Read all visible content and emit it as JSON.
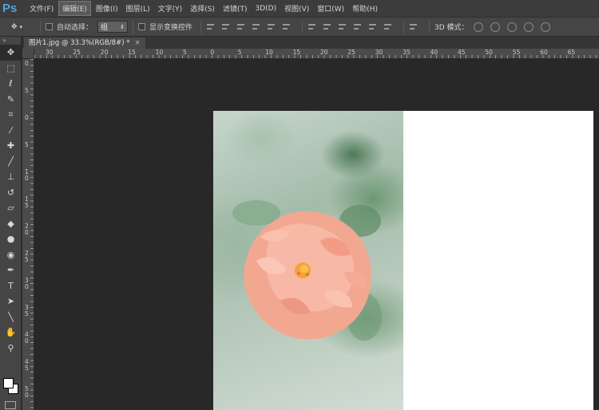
{
  "app": {
    "logo": "Ps"
  },
  "menu": [
    {
      "label": "文件(F)"
    },
    {
      "label": "编辑(E)"
    },
    {
      "label": "图像(I)"
    },
    {
      "label": "图层(L)"
    },
    {
      "label": "文字(Y)"
    },
    {
      "label": "选择(S)"
    },
    {
      "label": "滤镜(T)"
    },
    {
      "label": "3D(D)"
    },
    {
      "label": "视图(V)"
    },
    {
      "label": "窗口(W)"
    },
    {
      "label": "帮助(H)"
    }
  ],
  "options": {
    "tool_preset_icon": "move-tool-icon",
    "auto_select_label": "自动选择：",
    "auto_select_value": "组",
    "show_transform_label": "显示变换控件",
    "mode_label": "3D 模式："
  },
  "toolbox": {
    "collapse": "»",
    "tools": [
      {
        "name": "move-tool-icon",
        "glyph": "✥"
      },
      {
        "name": "marquee-tool-icon",
        "glyph": "⬚"
      },
      {
        "name": "lasso-tool-icon",
        "glyph": "ℓ"
      },
      {
        "name": "quick-select-tool-icon",
        "glyph": "✎"
      },
      {
        "name": "crop-tool-icon",
        "glyph": "⌗"
      },
      {
        "name": "eyedropper-tool-icon",
        "glyph": "⁄"
      },
      {
        "name": "healing-brush-tool-icon",
        "glyph": "✚"
      },
      {
        "name": "brush-tool-icon",
        "glyph": "╱"
      },
      {
        "name": "clone-stamp-tool-icon",
        "glyph": "⊥"
      },
      {
        "name": "history-brush-tool-icon",
        "glyph": "↺"
      },
      {
        "name": "eraser-tool-icon",
        "glyph": "▱"
      },
      {
        "name": "paint-bucket-tool-icon",
        "glyph": "◆"
      },
      {
        "name": "blur-tool-icon",
        "glyph": "●"
      },
      {
        "name": "dodge-tool-icon",
        "glyph": "◉"
      },
      {
        "name": "pen-tool-icon",
        "glyph": "✒"
      },
      {
        "name": "type-tool-icon",
        "glyph": "T"
      },
      {
        "name": "path-select-tool-icon",
        "glyph": "➤"
      },
      {
        "name": "line-tool-icon",
        "glyph": "╲"
      },
      {
        "name": "hand-tool-icon",
        "glyph": "✋"
      },
      {
        "name": "zoom-tool-icon",
        "glyph": "⚲"
      }
    ]
  },
  "document": {
    "tab_title": "图片1.jpg @ 33.3%(RGB/8#) *",
    "close": "×"
  },
  "ruler": {
    "top_labels": [
      "30",
      "25",
      "20",
      "15",
      "10",
      "5",
      "0",
      "5",
      "10",
      "15",
      "20",
      "25",
      "30",
      "35",
      "40",
      "45",
      "50",
      "55",
      "60",
      "65"
    ],
    "left_labels": [
      "0",
      "5",
      "0",
      "5",
      "1 0",
      "1 5",
      "2 0",
      "2 5",
      "3 0",
      "3 5",
      "4 0",
      "4 5",
      "5 0"
    ]
  }
}
